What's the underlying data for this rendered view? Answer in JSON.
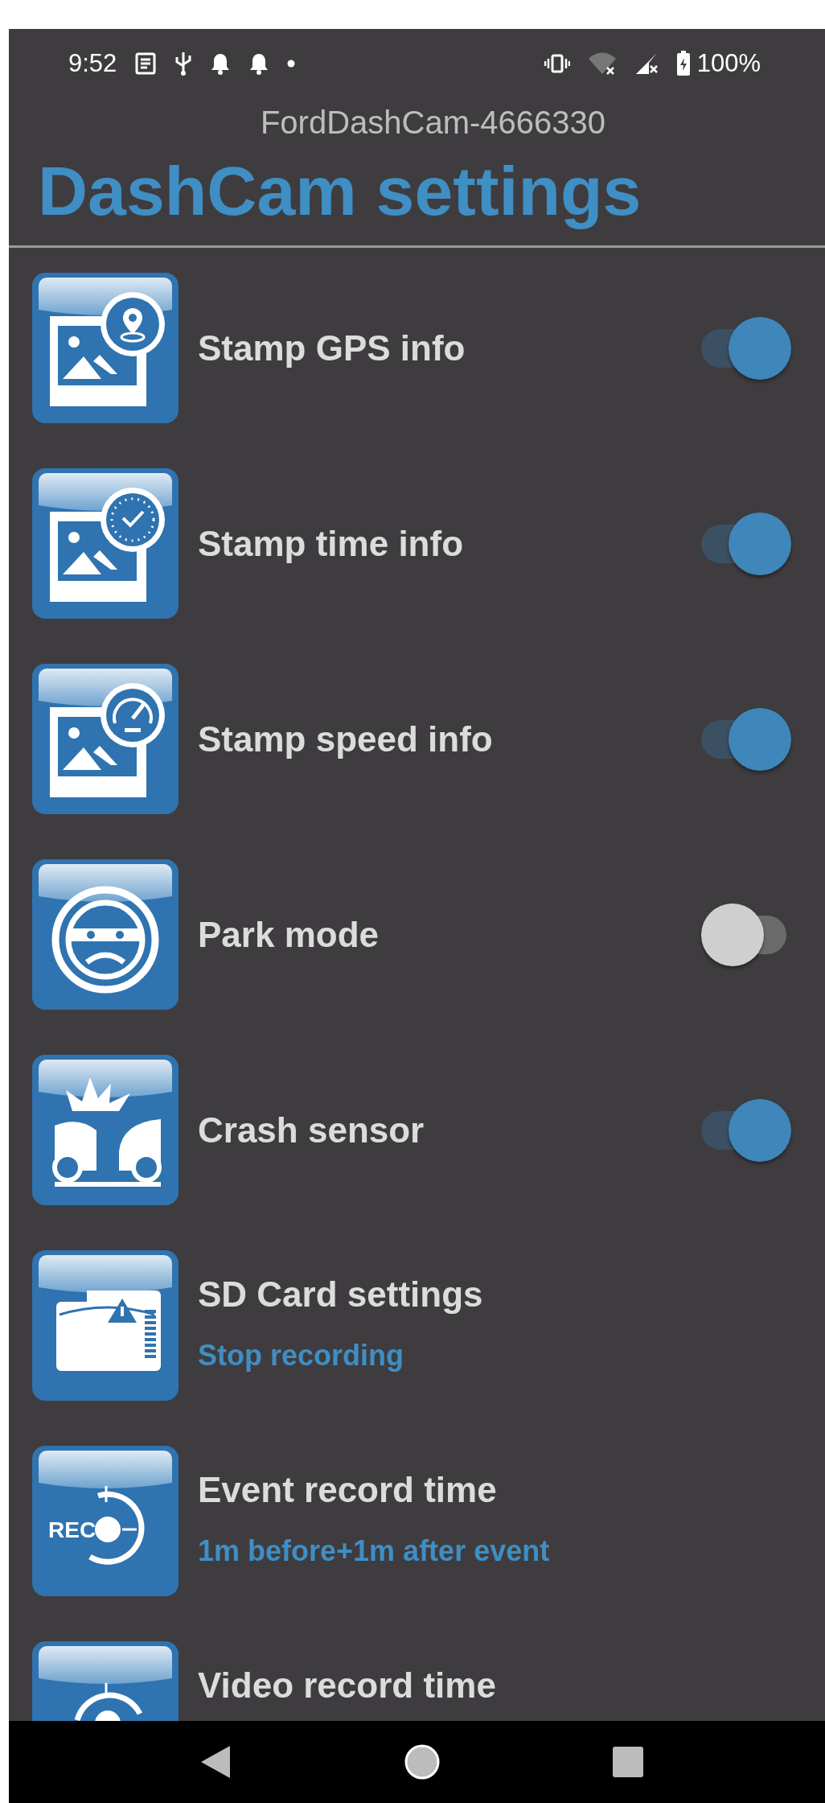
{
  "status_bar": {
    "time": "9:52",
    "battery": "100%"
  },
  "device_name": "FordDashCam-4666330",
  "title": "DashCam settings",
  "settings": [
    {
      "label": "Stamp GPS info",
      "kind": "toggle",
      "on": true
    },
    {
      "label": "Stamp time info",
      "kind": "toggle",
      "on": true
    },
    {
      "label": "Stamp speed info",
      "kind": "toggle",
      "on": true
    },
    {
      "label": "Park mode",
      "kind": "toggle",
      "on": false
    },
    {
      "label": "Crash sensor",
      "kind": "toggle",
      "on": true
    },
    {
      "label": "SD Card settings",
      "kind": "value",
      "value": "Stop recording"
    },
    {
      "label": "Event record time",
      "icon_text": "REC",
      "kind": "value",
      "value": "1m before+1m after event"
    },
    {
      "label": "Video record time",
      "kind": "value"
    }
  ]
}
